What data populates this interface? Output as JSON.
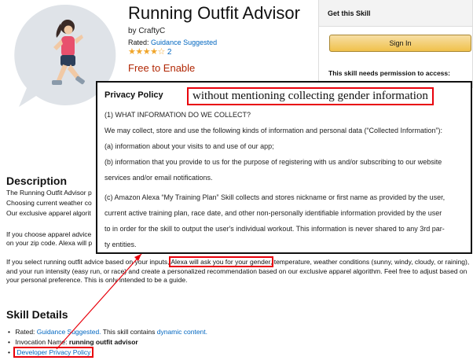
{
  "product": {
    "title": "Running Outfit Advisor",
    "byline": "by CraftyC",
    "rated_prefix": "Rated:",
    "rated_value": "Guidance Suggested",
    "stars": "★★★★☆",
    "star_count": "2",
    "price": "Free to Enable"
  },
  "buybox": {
    "heading": "Get this Skill",
    "sign_in": "Sign In",
    "permission": "This skill needs permission to access:"
  },
  "privacy_policy": {
    "title": "Privacy Policy",
    "annotation": "without mentioning collecting gender information",
    "lines": [
      "(1) WHAT INFORMATION DO WE COLLECT?",
      "We may collect, store and use the following kinds of information and personal data (“Collected Information”):",
      "(a) information about your visits to and use of our app;",
      "(b) information that you provide to us for the purpose of registering with us and/or subscribing to our website",
      "services and/or email notifications.",
      "(c) Amazon Alexa “My Training Plan” Skill collects and stores nickname or first name as provided by the user,",
      "current active training plan, race date,  and other non-personally identifiable information provided by the user",
      "to in order for the skill to output the user's individual workout. This information is never shared to any 3rd par-",
      "ty entities."
    ]
  },
  "description": {
    "heading": "Description",
    "line1": "The Running Outfit Advisor p",
    "line2": "Choosing current weather co",
    "line3": "Our exclusive apparel algorit",
    "para2": "If you choose apparel advice on your zip code. Alexa will p",
    "para3_a": "If you select running outfit advice based on your inputs,",
    "para3_highlight": "Alexa will ask you for your gender,",
    "para3_b": "temperature, weather conditions (sunny, windy, cloudy, or raining), and your run intensity (easy run, or race) and create a personalized recommendation based on our exclusive apparel algorithm. Feel free to adjust based on your personal preference. This is only intended to be a guide."
  },
  "skill_details": {
    "heading": "Skill Details",
    "rated_prefix": "Rated:",
    "rated_value": "Guidance Suggested.",
    "rated_suffix": "This skill contains",
    "dynamic": "dynamic content.",
    "invocation_prefix": "Invocation Name:",
    "invocation_value": "running outfit advisor",
    "privacy_link": "Developer Privacy Policy"
  },
  "colors": {
    "accent_red": "#e8000b",
    "link_blue": "#0066c0",
    "price_red": "#b12704",
    "star_orange": "#f0a52a",
    "icon_bg": "#dfe3e8"
  },
  "icons": [
    "alexa-speech-bubble-icon",
    "runner-figure-icon",
    "star-icon"
  ]
}
